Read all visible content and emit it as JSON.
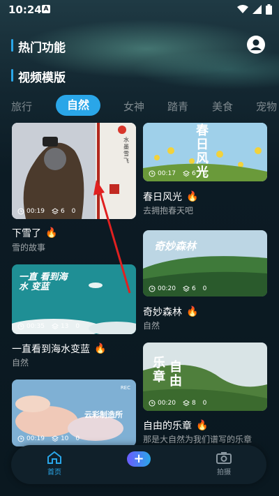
{
  "status": {
    "time": "10:24",
    "badge": "A"
  },
  "sections": {
    "hot": "热门功能",
    "templates": "视频模版"
  },
  "tabs": [
    "旅行",
    "自然",
    "女神",
    "踏青",
    "美食",
    "宠物"
  ],
  "active_tab": "自然",
  "cards": [
    {
      "id": "snow",
      "title": "下雪了",
      "sub": "雪的故事",
      "duration": "00:19",
      "layers": "6",
      "count": "0"
    },
    {
      "id": "spring",
      "title": "春日风光",
      "sub": "去拥抱春天吧",
      "duration": "00:17",
      "layers": "6",
      "count": "0",
      "overlay": "春日风光"
    },
    {
      "id": "forest",
      "title": "奇妙森林",
      "sub": "自然",
      "duration": "00:20",
      "layers": "6",
      "count": "0",
      "overlay": "奇妙森林"
    },
    {
      "id": "sea",
      "title": "一直看到海水变蓝",
      "sub": "自然",
      "duration": "00:35",
      "layers": "13",
      "count": "0",
      "overlay": "一直 看到海水 变蓝"
    },
    {
      "id": "freedom",
      "title": "自由的乐章",
      "sub": "那是大自然为我们谱写的乐章",
      "duration": "00:20",
      "layers": "8",
      "count": "0",
      "overlay_a": "乐章",
      "overlay_b": "自由"
    },
    {
      "id": "cloud",
      "title": "",
      "sub": "",
      "duration": "00:19",
      "layers": "10",
      "count": "0",
      "overlay": "云彩制造所",
      "rec": "REC"
    }
  ],
  "snow_overlay": "水墨雪飞",
  "nav": {
    "home": "首页",
    "shoot": "拍摄",
    "plus": "+"
  },
  "colors": {
    "accent": "#2aa6e8",
    "fire": "#ff8a1c",
    "arrow": "#e02020"
  }
}
